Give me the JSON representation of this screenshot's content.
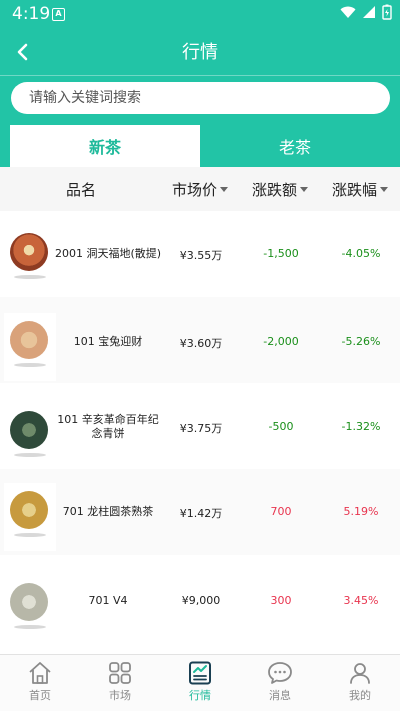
{
  "status": {
    "time": "4:19",
    "app_badge": "A"
  },
  "header": {
    "title": "行情"
  },
  "search": {
    "placeholder": "请输入关键词搜索"
  },
  "tabs": [
    {
      "label": "新茶",
      "active": true
    },
    {
      "label": "老茶",
      "active": false
    }
  ],
  "table": {
    "columns": {
      "name": "品名",
      "price": "市场价",
      "change": "涨跌额",
      "pct": "涨跌幅"
    },
    "rows": [
      {
        "name": "2001 洞天福地(散提)",
        "price": "¥3.55万",
        "change": "-1,500",
        "pct": "-4.05%",
        "trend": "down",
        "thumb_color": "#c8643a"
      },
      {
        "name": "101 宝兔迎财",
        "price": "¥3.60万",
        "change": "-2,000",
        "pct": "-5.26%",
        "trend": "down",
        "thumb_color": "#d9a27a"
      },
      {
        "name": "101 辛亥革命百年纪念青饼",
        "price": "¥3.75万",
        "change": "-500",
        "pct": "-1.32%",
        "trend": "down",
        "thumb_color": "#2f4a3a"
      },
      {
        "name": "701 龙柱圆茶熟茶",
        "price": "¥1.42万",
        "change": "700",
        "pct": "5.19%",
        "trend": "up",
        "thumb_color": "#c79a3e"
      },
      {
        "name": "701 V4",
        "price": "¥9,000",
        "change": "300",
        "pct": "3.45%",
        "trend": "up",
        "thumb_color": "#b7b7a8"
      }
    ]
  },
  "nav": [
    {
      "label": "首页",
      "icon": "home-icon",
      "active": false
    },
    {
      "label": "市场",
      "icon": "market-icon",
      "active": false
    },
    {
      "label": "行情",
      "icon": "chart-icon",
      "active": true
    },
    {
      "label": "消息",
      "icon": "message-icon",
      "active": false
    },
    {
      "label": "我的",
      "icon": "profile-icon",
      "active": false
    }
  ],
  "colors": {
    "primary": "#22c4a6",
    "down": "#1a8f1a",
    "up": "#e8344e"
  }
}
